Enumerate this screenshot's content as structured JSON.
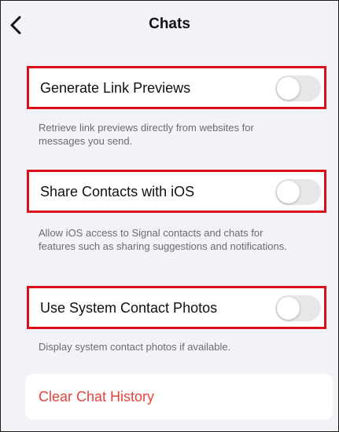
{
  "nav": {
    "title": "Chats",
    "back_icon": "chevron-left-icon"
  },
  "settings": [
    {
      "label": "Generate Link Previews",
      "enabled": false,
      "description": "Retrieve link previews directly from websites for messages you send."
    },
    {
      "label": "Share Contacts with iOS",
      "enabled": false,
      "description": "Allow iOS access to Signal contacts and chats for features such as sharing suggestions and notifications."
    },
    {
      "label": "Use System Contact Photos",
      "enabled": false,
      "description": "Display system contact photos if available."
    }
  ],
  "actions": {
    "clear_history_label": "Clear Chat History"
  },
  "colors": {
    "background": "#f2f2f7",
    "highlight_border": "#d9101a",
    "destructive": "#e9423a",
    "toggle_off": "#e7e7e9"
  }
}
